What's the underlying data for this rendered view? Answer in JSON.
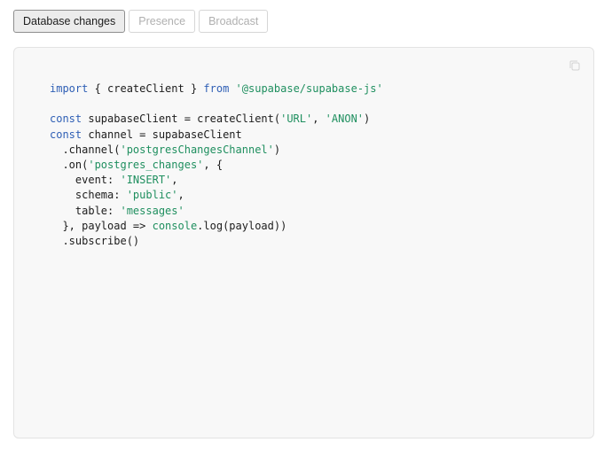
{
  "tabs": [
    {
      "label": "Database changes",
      "active": true
    },
    {
      "label": "Presence",
      "active": false
    },
    {
      "label": "Broadcast",
      "active": false
    }
  ],
  "code": {
    "copy_icon": "copy-icon",
    "tokens": {
      "import_kw": "import",
      "import_brace_open": " { createClient } ",
      "from_kw": "from",
      "module": "'@supabase/supabase-js'",
      "const_kw": "const",
      "client_decl": " supabaseClient = createClient(",
      "url": "'URL'",
      "comma_sp": ", ",
      "anon": "'ANON'",
      "close_paren": ")",
      "channel_decl": " channel = supabaseClient",
      "channel_call": "  .channel(",
      "channel_name": "'postgresChangesChannel'",
      "on_call": "  .on(",
      "event_name": "'postgres_changes'",
      "on_tail": ", {",
      "event_key": "    event: ",
      "event_val": "'INSERT'",
      "schema_key": "    schema: ",
      "schema_val": "'public'",
      "table_key": "    table: ",
      "table_val": "'messages'",
      "cb_head": "  }, payload => ",
      "console": "console",
      "cb_tail": ".log(payload))",
      "subscribe": "  .subscribe()"
    }
  }
}
